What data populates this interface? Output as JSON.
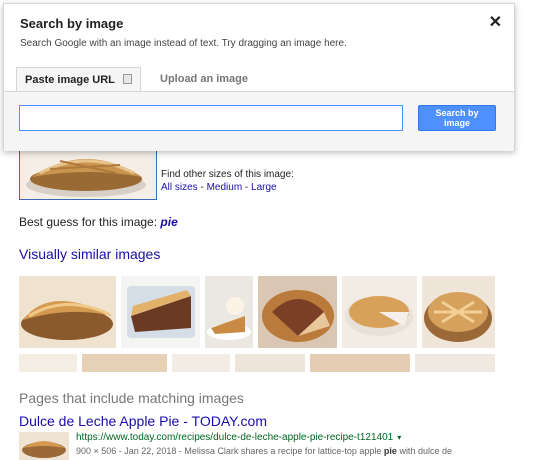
{
  "dialog": {
    "title": "Search by image",
    "subtitle": "Search Google with an image instead of text. Try dragging an image here.",
    "close_label": "✕",
    "tabs": [
      {
        "label": "Paste image URL"
      },
      {
        "label": "Upload an image"
      }
    ],
    "input_value": "",
    "search_button_label": "Search by image"
  },
  "result": {
    "find_sizes_label": "Find other sizes of this image:",
    "size_links": [
      "All sizes",
      "Medium",
      "Large"
    ],
    "size_sep": " - ",
    "best_guess_label": "Best guess for this image:",
    "best_guess_value": "pie"
  },
  "similar": {
    "title": "Visually similar images"
  },
  "pages": {
    "title": "Pages that include matching images",
    "items": [
      {
        "title": "Dulce de Leche Apple Pie - TODAY.com",
        "url": "https://www.today.com/recipes/dulce-de-leche-apple-pie-recipe-t121401",
        "caret": "▾",
        "meta": "900 × 506 - Jan 22, 2018 - Melissa Clark shares a recipe for lattice-top apple ",
        "meta_bold": "pie",
        "meta_end": " with dulce de"
      }
    ]
  },
  "colors": {
    "link": "#1a0dab",
    "url": "#006621",
    "button": "#4d90fe"
  }
}
